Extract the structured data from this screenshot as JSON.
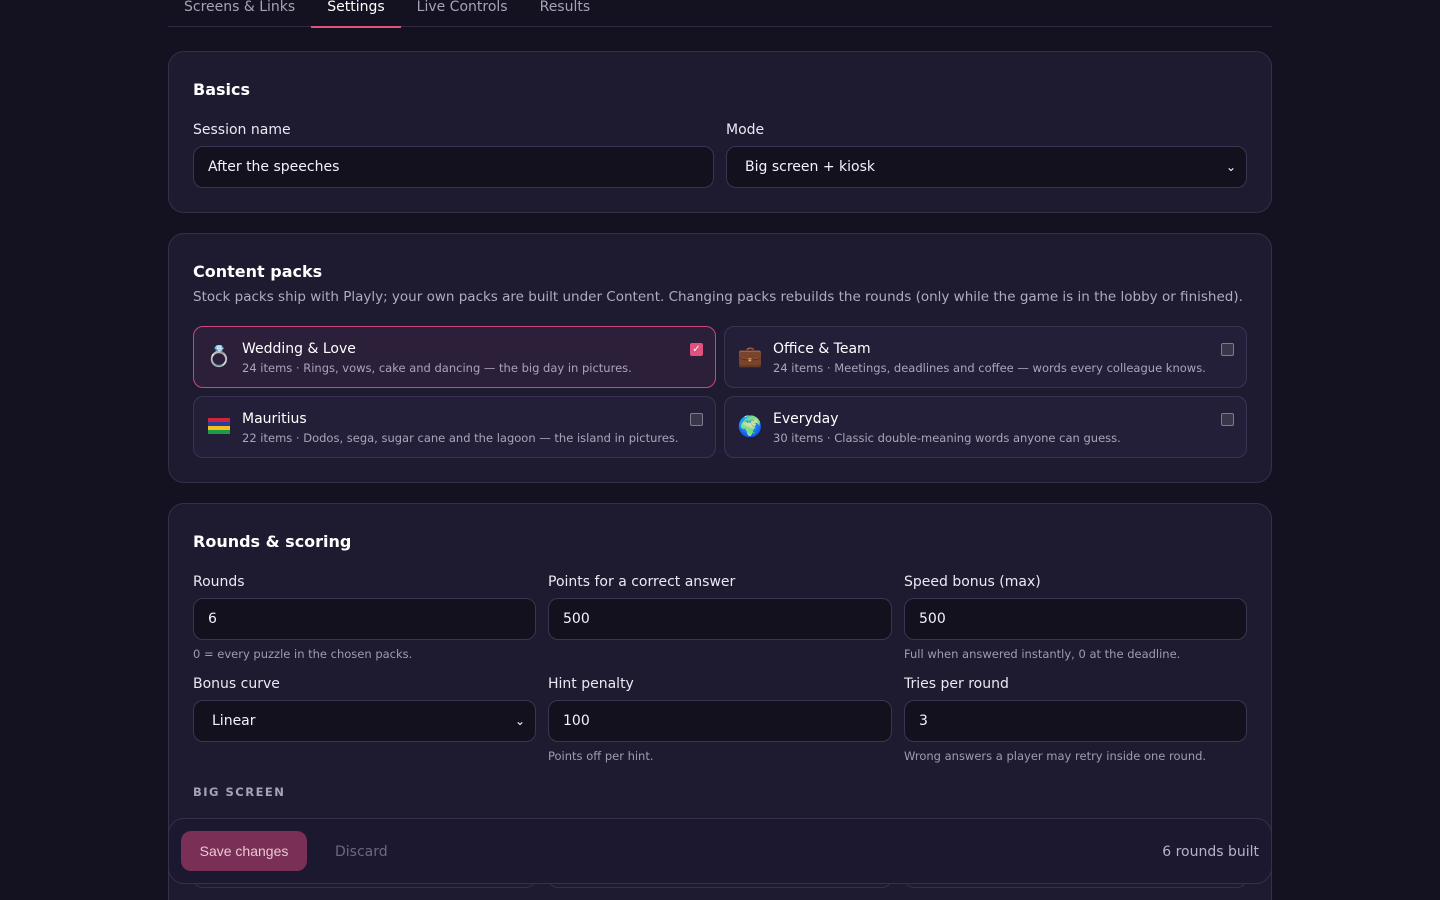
{
  "tabs": [
    {
      "label": "Screens & Links"
    },
    {
      "label": "Settings"
    },
    {
      "label": "Live Controls"
    },
    {
      "label": "Results"
    }
  ],
  "active_tab": "Settings",
  "basics": {
    "title": "Basics",
    "session_name_label": "Session name",
    "session_name_value": "After the speeches",
    "mode_label": "Mode",
    "mode_value": "Big screen + kiosk"
  },
  "content_packs": {
    "title": "Content packs",
    "description": "Stock packs ship with Playly; your own packs are built under Content. Changing packs rebuilds the rounds (only while the game is in the lobby or finished).",
    "packs": [
      {
        "icon": "ring-icon",
        "glyph": "💍",
        "name": "Wedding & Love",
        "meta": "24 items · Rings, vows, cake and dancing — the big day in pictures.",
        "checked": true
      },
      {
        "icon": "briefcase-icon",
        "glyph": "💼",
        "name": "Office & Team",
        "meta": "24 items · Meetings, deadlines and coffee — words every colleague knows.",
        "checked": false
      },
      {
        "icon": "mauritius-flag-icon",
        "glyph": "",
        "name": "Mauritius",
        "meta": "22 items · Dodos, sega, sugar cane and the lagoon — the island in pictures.",
        "checked": false
      },
      {
        "icon": "globe-icon",
        "glyph": "🌍",
        "name": "Everyday",
        "meta": "30 items · Classic double-meaning words anyone can guess.",
        "checked": false
      }
    ]
  },
  "rounds": {
    "title": "Rounds & scoring",
    "rounds_label": "Rounds",
    "rounds_value": "6",
    "rounds_hint": "0 = every puzzle in the chosen packs.",
    "points_label": "Points for a correct answer",
    "points_value": "500",
    "speed_label": "Speed bonus (max)",
    "speed_value": "500",
    "speed_hint": "Full when answered instantly, 0 at the deadline.",
    "curve_label": "Bonus curve",
    "curve_value": "Linear",
    "hint_penalty_label": "Hint penalty",
    "hint_penalty_value": "100",
    "hint_penalty_hint": "Points off per hint.",
    "tries_label": "Tries per round",
    "tries_value": "3",
    "tries_hint": "Wrong answers a player may retry inside one round.",
    "big_screen_label": "BIG SCREEN"
  },
  "savebar": {
    "save_label": "Save changes",
    "discard_label": "Discard",
    "status": "6 rounds built"
  },
  "colors": {
    "accent": "#e0527e",
    "background": "#141120",
    "card": "#1e1a30"
  }
}
